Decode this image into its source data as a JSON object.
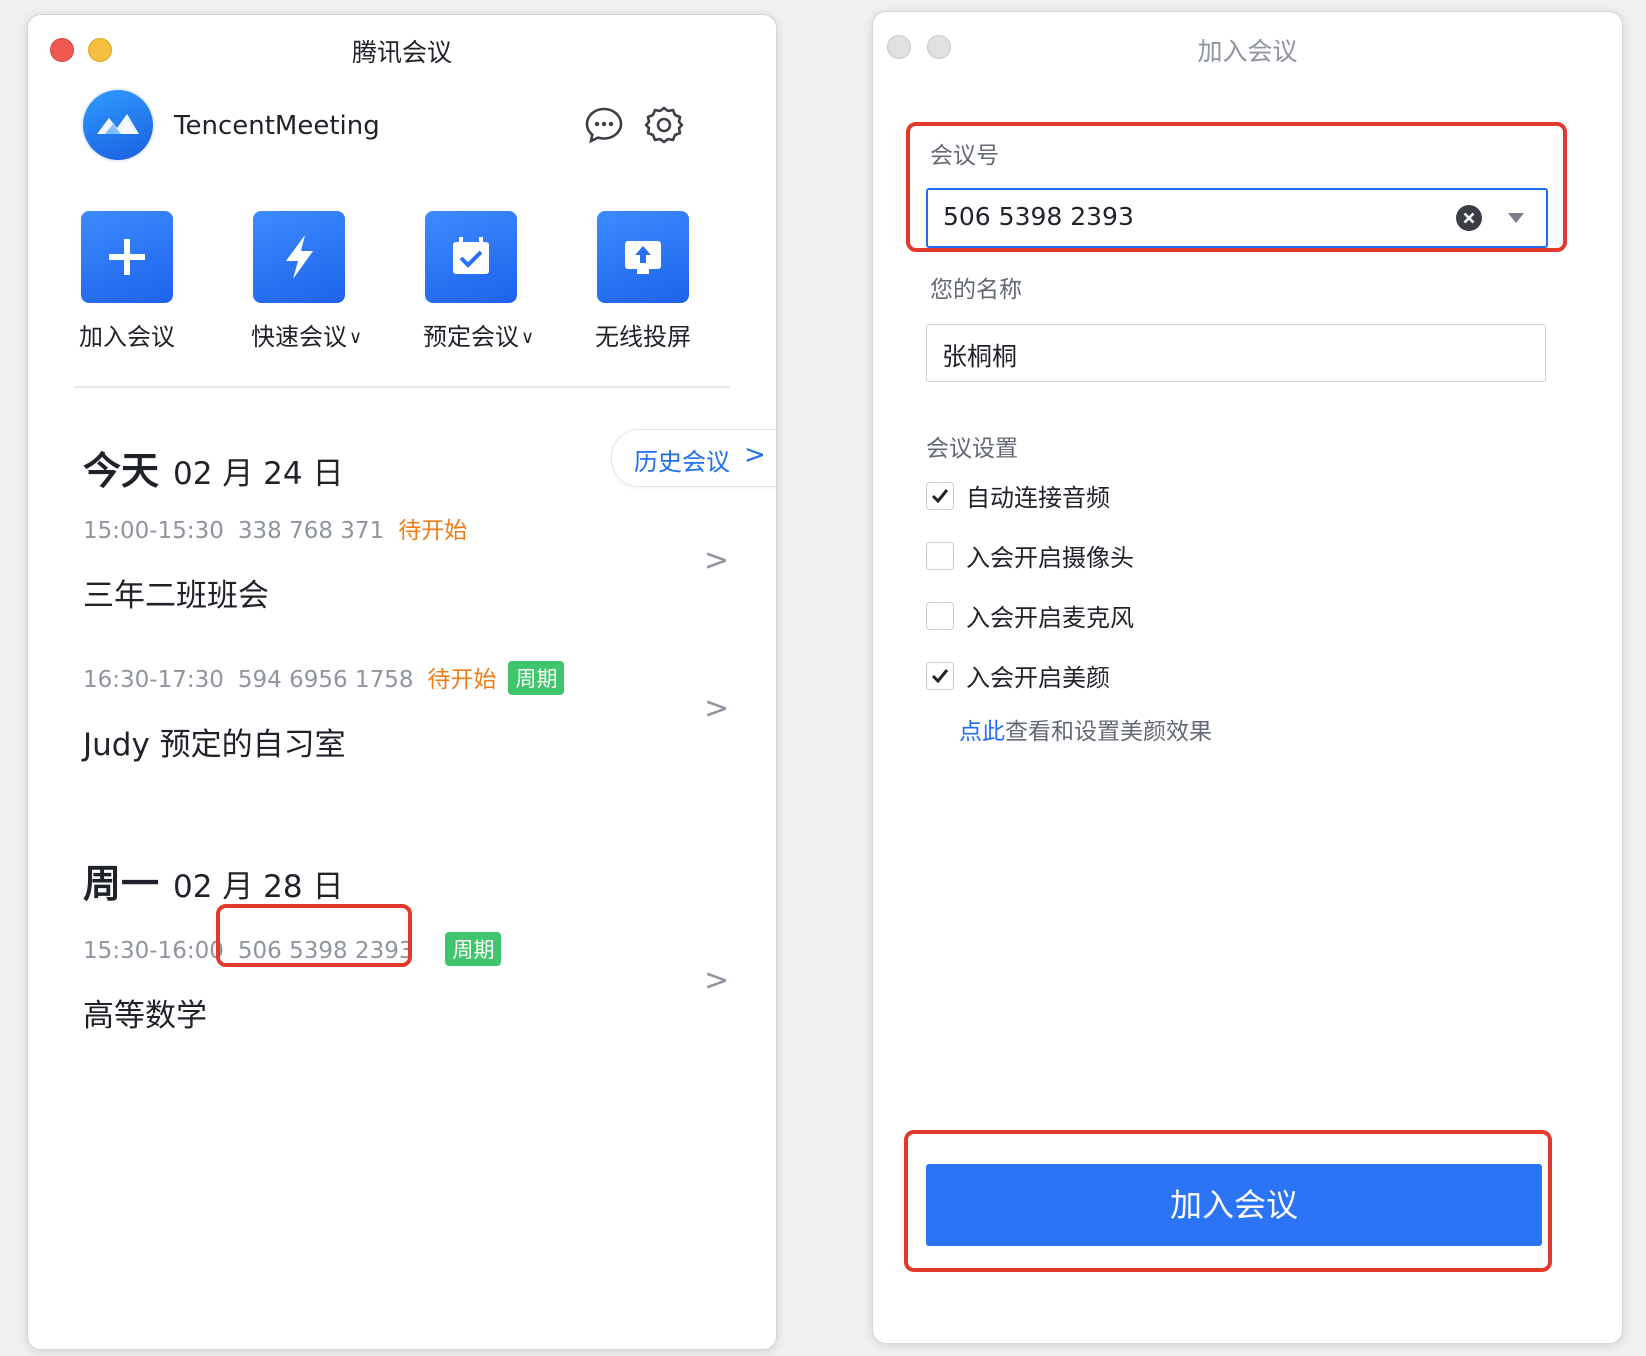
{
  "left_window": {
    "title": "腾讯会议",
    "brand": "TencentMeeting",
    "actions": [
      {
        "label": "加入会议",
        "icon": "plus-icon",
        "has_dropdown": false
      },
      {
        "label": "快速会议",
        "icon": "lightning-icon",
        "has_dropdown": true
      },
      {
        "label": "预定会议",
        "icon": "calendar-check-icon",
        "has_dropdown": true
      },
      {
        "label": "无线投屏",
        "icon": "screen-share-icon",
        "has_dropdown": false
      }
    ],
    "history_button": "历史会议",
    "days": [
      {
        "name": "今天",
        "date": "02 月 24 日",
        "meetings": [
          {
            "time": "15:00-15:30",
            "id": "338 768 371",
            "status": "待开始",
            "tag": "",
            "title": "三年二班班会"
          },
          {
            "time": "16:30-17:30",
            "id": "594 6956 1758",
            "status": "待开始",
            "tag": "周期",
            "title": "Judy 预定的自习室"
          }
        ]
      },
      {
        "name": "周一",
        "date": "02 月 28 日",
        "meetings": [
          {
            "time": "15:30-16:00",
            "id": "506 5398 2393",
            "status": "",
            "tag": "周期",
            "title": "高等数学"
          }
        ]
      }
    ],
    "icons": {
      "chat": "chat-bubble-icon",
      "settings": "gear-icon",
      "chevron": "chevron-right-icon"
    },
    "colors": {
      "accent": "#1f6ff0",
      "pending": "#f07c1a",
      "tag": "#3fc56b",
      "highlight": "#e23a2a"
    }
  },
  "right_window": {
    "title": "加入会议",
    "meeting_id_label": "会议号",
    "meeting_id_value": "506 5398 2393",
    "name_label": "您的名称",
    "name_value": "张桐桐",
    "settings_label": "会议设置",
    "options": [
      {
        "label": "自动连接音频",
        "checked": true
      },
      {
        "label": "入会开启摄像头",
        "checked": false
      },
      {
        "label": "入会开启麦克风",
        "checked": false
      },
      {
        "label": "入会开启美颜",
        "checked": true
      }
    ],
    "beauty_link": "点此",
    "beauty_text": "查看和设置美颜效果",
    "join_button": "加入会议",
    "colors": {
      "button": "#2b74f5"
    }
  }
}
